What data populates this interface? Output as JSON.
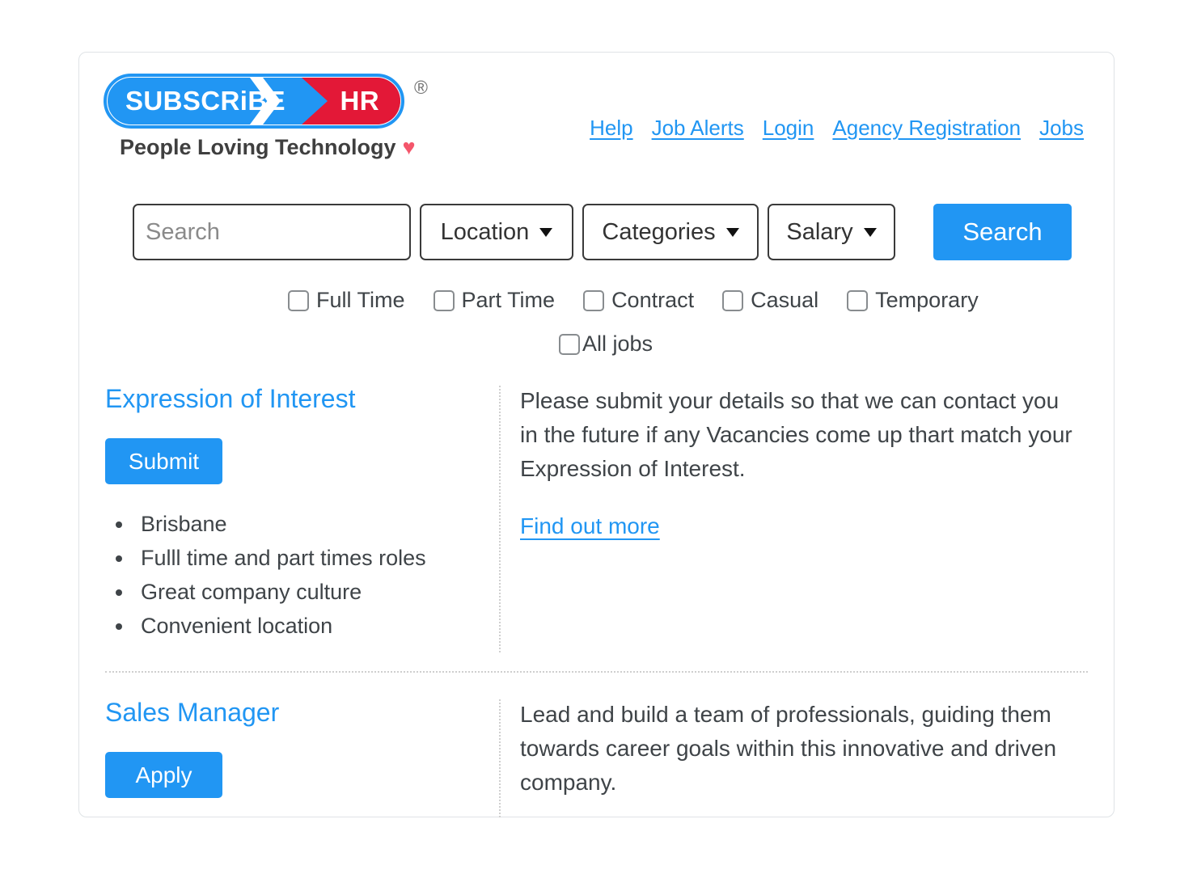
{
  "brand": {
    "logo_left": "SUBSCRiBE",
    "logo_right": "HR",
    "registered_mark": "®",
    "tagline": "People Loving Technology",
    "heart_icon": "♥",
    "blue": "#2196f3",
    "red": "#e31837",
    "heart_color": "#f4566b"
  },
  "topnav": {
    "items": [
      {
        "label": "Help"
      },
      {
        "label": "Job Alerts"
      },
      {
        "label": "Login"
      },
      {
        "label": "Agency Registration"
      },
      {
        "label": "Jobs"
      }
    ]
  },
  "search": {
    "keyword_placeholder": "Search",
    "keyword_value": "",
    "location_label": "Location",
    "categories_label": "Categories",
    "salary_label": "Salary",
    "button_label": "Search"
  },
  "job_types": {
    "row1": [
      {
        "label": "Full Time",
        "checked": false
      },
      {
        "label": "Part Time",
        "checked": false
      },
      {
        "label": "Contract",
        "checked": false
      },
      {
        "label": "Casual",
        "checked": false
      },
      {
        "label": "Temporary",
        "checked": false
      }
    ],
    "row2": [
      {
        "label": "All jobs",
        "checked": false
      }
    ]
  },
  "listings": [
    {
      "title": "Expression of Interest",
      "action_label": "Submit",
      "bullets": [
        "Brisbane",
        "Fulll time and part times roles",
        "Great company culture",
        "Convenient location"
      ],
      "description": "Please submit your details so that we can contact you in the future if any Vacancies come up thart match your Expression of Interest.",
      "link_label": "Find out more"
    },
    {
      "title": "Sales Manager",
      "action_label": "Apply",
      "bullets": [],
      "description": "Lead and build a team of professionals, guiding them towards career goals within this innovative and driven company.",
      "link_label": ""
    }
  ]
}
